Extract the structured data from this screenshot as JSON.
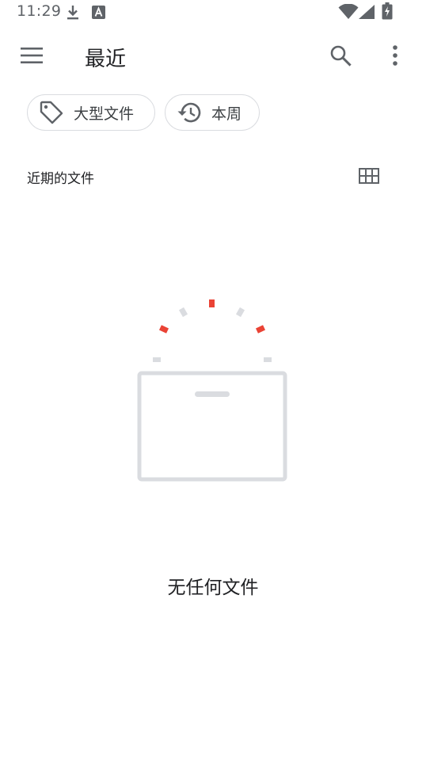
{
  "status_bar": {
    "time": "11:29",
    "icons": [
      "download-icon",
      "a-icon",
      "wifi-icon",
      "signal-icon",
      "battery-charging-icon"
    ]
  },
  "app_bar": {
    "title": "最近",
    "menu_icon": "menu-icon",
    "search_icon": "search-icon",
    "more_icon": "more-vert-icon"
  },
  "chips": [
    {
      "label": "大型文件",
      "icon": "label-tag-icon"
    },
    {
      "label": "本周",
      "icon": "history-icon"
    }
  ],
  "section": {
    "label": "近期的文件",
    "view_icon": "grid-view-icon"
  },
  "empty_state": {
    "message": "无任何文件",
    "icon": "empty-box-illustration"
  },
  "colors": {
    "accent_red": "#ea4335",
    "illustration_gray": "#dadce0",
    "text_primary": "#202124",
    "icon_gray": "#5f6368"
  }
}
